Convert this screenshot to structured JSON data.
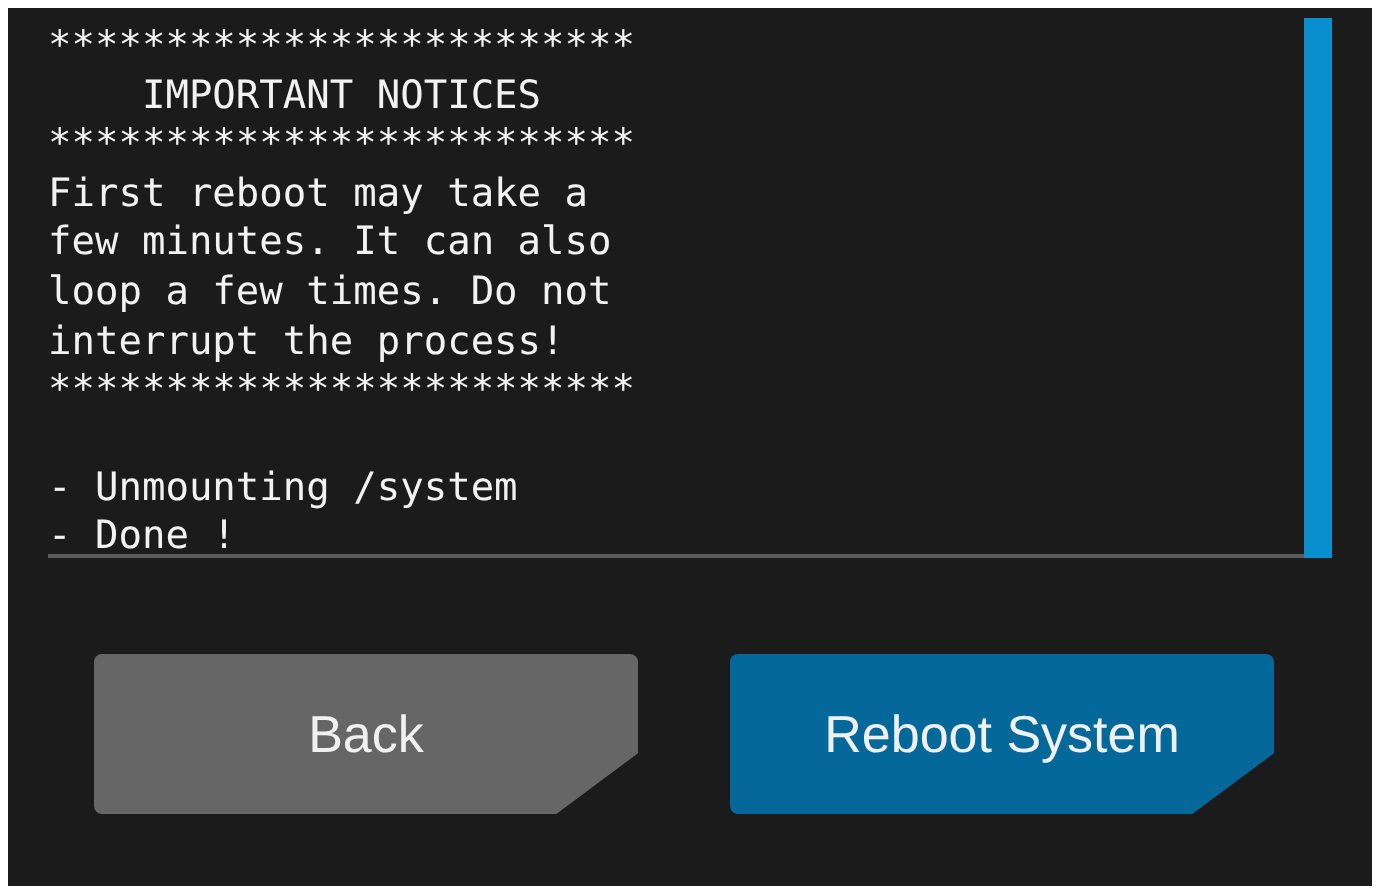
{
  "console": {
    "blocks": [
      [
        "*************************",
        "    IMPORTANT NOTICES",
        "*************************",
        "First reboot may take a",
        "few minutes. It can also",
        "loop a few times. Do not",
        "interrupt the process!",
        "*************************"
      ],
      [
        "- Unmounting /system",
        "- Done !"
      ]
    ]
  },
  "buttons": [
    {
      "label": "Back",
      "kind": "secondary"
    },
    {
      "label": "Reboot System",
      "kind": "primary"
    }
  ]
}
